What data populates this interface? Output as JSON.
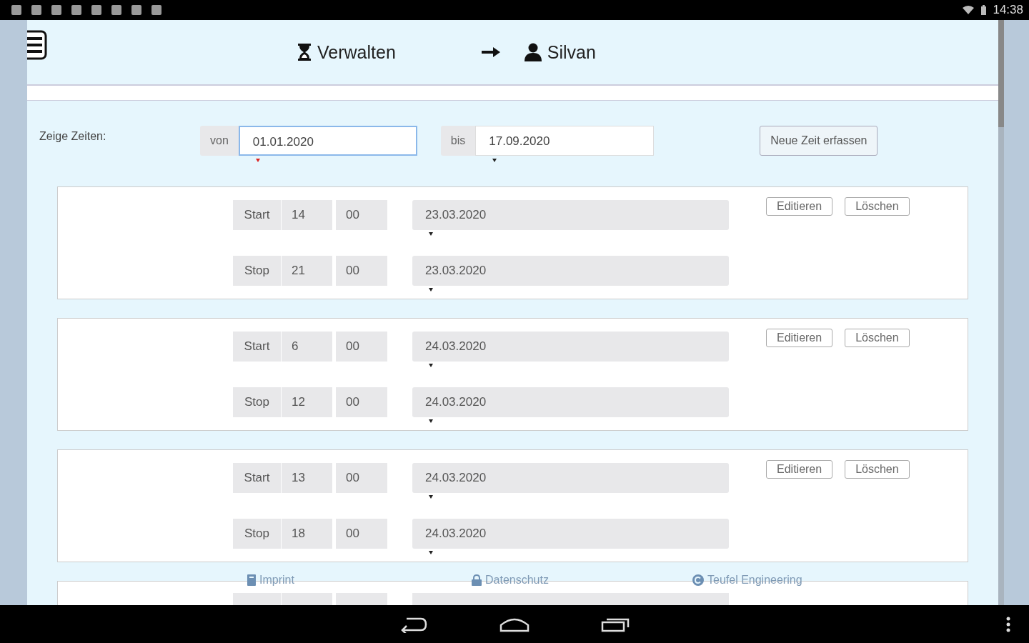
{
  "status_bar": {
    "time": "14:38"
  },
  "header": {
    "section": "Verwalten",
    "user": "Silvan"
  },
  "filter": {
    "label": "Zeige Zeiten:",
    "from_label": "von",
    "from_value": "01.01.2020",
    "from_focused": true,
    "to_label": "bis",
    "to_value": "17.09.2020",
    "to_focused": false,
    "new_button": "Neue Zeit erfassen"
  },
  "entries": [
    {
      "start_label": "Start",
      "start_hour": "14",
      "start_minute": "00",
      "start_date": "23.03.2020",
      "stop_label": "Stop",
      "stop_hour": "21",
      "stop_minute": "00",
      "stop_date": "23.03.2020",
      "edit_button": "Editieren",
      "delete_button": "Löschen"
    },
    {
      "start_label": "Start",
      "start_hour": "6",
      "start_minute": "00",
      "start_date": "24.03.2020",
      "stop_label": "Stop",
      "stop_hour": "12",
      "stop_minute": "00",
      "stop_date": "24.03.2020",
      "edit_button": "Editieren",
      "delete_button": "Löschen"
    },
    {
      "start_label": "Start",
      "start_hour": "13",
      "start_minute": "00",
      "start_date": "24.03.2020",
      "stop_label": "Stop",
      "stop_hour": "18",
      "stop_minute": "00",
      "stop_date": "24.03.2020",
      "edit_button": "Editieren",
      "delete_button": "Löschen"
    }
  ],
  "footer": {
    "imprint": "Imprint",
    "privacy": "Datenschutz",
    "company": "Teufel Engineering"
  }
}
